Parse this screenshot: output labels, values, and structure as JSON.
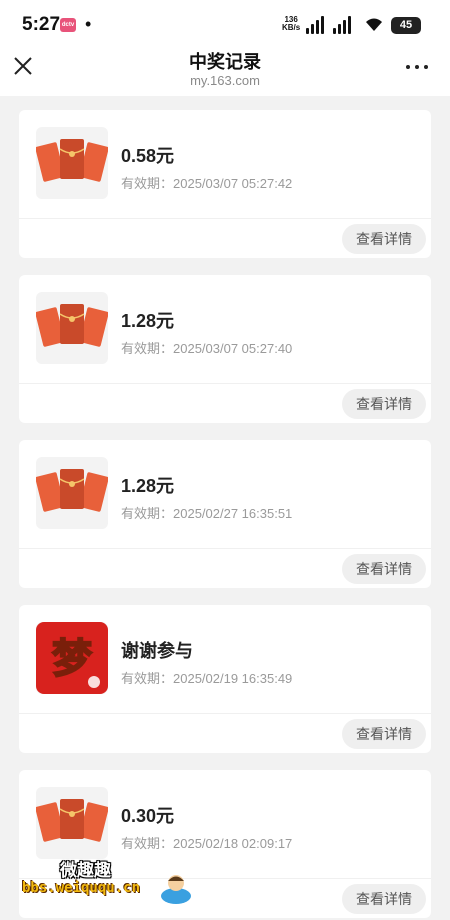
{
  "status_bar": {
    "time": "5:27",
    "app_badge": "dctv",
    "dot": "•",
    "speed_value": "136",
    "speed_unit": "KB/s",
    "battery": "45"
  },
  "nav": {
    "title": "中奖记录",
    "url": "my.163.com"
  },
  "records": [
    {
      "amount": "0.58元",
      "expiry": "有效期：2025/03/07 05:27:42",
      "button": "查看详情",
      "thumb_icon": "red-envelope-icon"
    },
    {
      "amount": "1.28元",
      "expiry": "有效期：2025/03/07 05:27:40",
      "button": "查看详情",
      "thumb_icon": "red-envelope-icon"
    },
    {
      "amount": "1.28元",
      "expiry": "有效期：2025/02/27 16:35:51",
      "button": "查看详情",
      "thumb_icon": "red-envelope-icon"
    },
    {
      "amount": "谢谢参与",
      "expiry": "有效期：2025/02/19 16:35:49",
      "button": "查看详情",
      "thumb_icon": "game-logo-icon"
    },
    {
      "amount": "0.30元",
      "expiry": "有效期：2025/02/18 02:09:17",
      "button": "查看详情",
      "thumb_icon": "red-envelope-icon"
    }
  ],
  "watermark": {
    "top": "微趣趣",
    "bottom": "bbs.weiququ.cn"
  },
  "colors": {
    "envelope": "#e8603a",
    "envelope_dark": "#c94a2a",
    "gold": "#f5c56a",
    "background": "#f2f2f2"
  }
}
